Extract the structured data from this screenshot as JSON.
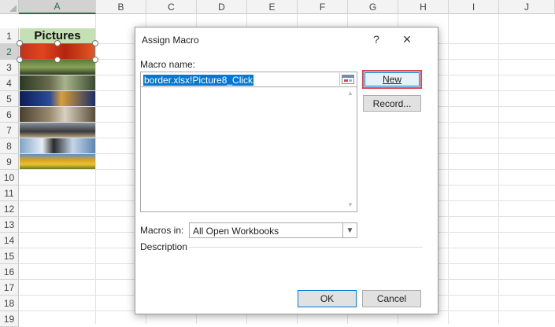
{
  "sheet": {
    "columns": [
      "A",
      "B",
      "C",
      "D",
      "E",
      "F",
      "G",
      "H",
      "I",
      "J"
    ],
    "rows": [
      "1",
      "2",
      "3",
      "4",
      "5",
      "6",
      "7",
      "8",
      "9",
      "10",
      "11",
      "12",
      "13",
      "14",
      "15",
      "16",
      "17",
      "18",
      "19"
    ],
    "a1_text": "Pictures",
    "selected_column": "A",
    "selected_row": "2",
    "header_color": "#c5e0b4"
  },
  "dialog": {
    "title": "Assign Macro",
    "help": "?",
    "close": "×",
    "macro_name_label": "Macro name:",
    "macro_name_value": "border.xlsx!Picture8_Click",
    "new_button": "New",
    "record_button": "Record...",
    "macros_in_label": "Macros in:",
    "macros_in_value": "All Open Workbooks",
    "description_label": "Description",
    "ok_button": "OK",
    "cancel_button": "Cancel"
  }
}
